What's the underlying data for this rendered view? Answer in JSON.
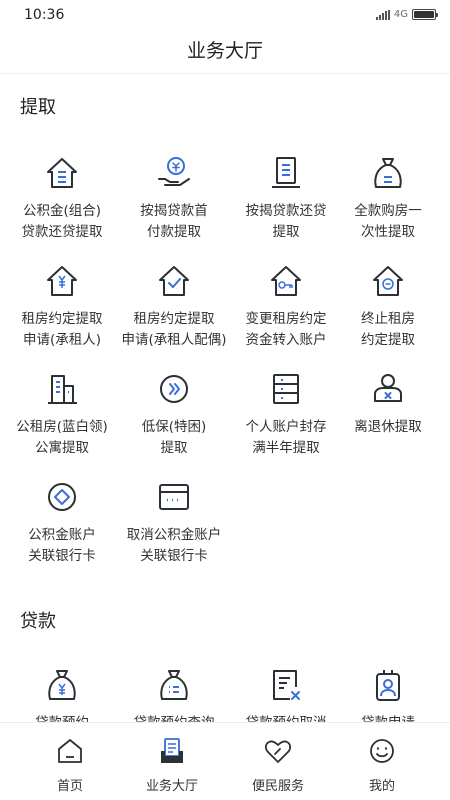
{
  "status_bar": {
    "time": "10:36",
    "network": "4G"
  },
  "header": {
    "title": "业务大厅"
  },
  "sections": [
    {
      "title": "提取",
      "items": [
        {
          "line1": "公积金(组合)",
          "line2": "贷款还贷提取",
          "icon": "house-list-icon"
        },
        {
          "line1": "按揭贷款首",
          "line2": "付款提取",
          "icon": "hand-coin-icon"
        },
        {
          "line1": "按揭贷款还贷",
          "line2": "提取",
          "icon": "receipt-icon"
        },
        {
          "line1": "全款购房一",
          "line2": "次性提取",
          "icon": "money-bag-icon"
        },
        {
          "line1": "租房约定提取",
          "line2": "申请(承租人)",
          "icon": "house-yen-icon"
        },
        {
          "line1": "租房约定提取",
          "line2": "申请(承租人配偶)",
          "icon": "house-check-icon"
        },
        {
          "line1": "变更租房约定",
          "line2": "资金转入账户",
          "icon": "house-key-icon"
        },
        {
          "line1": "终止租房",
          "line2": "约定提取",
          "icon": "house-minus-icon"
        },
        {
          "line1": "公租房(蓝白领)",
          "line2": "公寓提取",
          "icon": "building-icon"
        },
        {
          "line1": "低保(特困)",
          "line2": "提取",
          "icon": "double-chevron-icon"
        },
        {
          "line1": "个人账户封存",
          "line2": "满半年提取",
          "icon": "archive-icon"
        },
        {
          "line1": "离退休提取",
          "line2": "",
          "icon": "retiree-icon"
        },
        {
          "line1": "公积金账户",
          "line2": "关联银行卡",
          "icon": "diamond-circle-icon"
        },
        {
          "line1": "取消公积金账户",
          "line2": "关联银行卡",
          "icon": "bank-card-icon"
        }
      ]
    },
    {
      "title": "贷款",
      "items": [
        {
          "line1": "贷款预约",
          "line2": "",
          "icon": "money-bag-yen-icon"
        },
        {
          "line1": "贷款预约查询",
          "line2": "",
          "icon": "money-bag-list-icon"
        },
        {
          "line1": "贷款预约取消",
          "line2": "",
          "icon": "document-cancel-icon"
        },
        {
          "line1": "贷款申请",
          "line2": "",
          "icon": "id-badge-icon"
        }
      ]
    }
  ],
  "tabs": [
    {
      "label": "首页",
      "icon": "home-icon"
    },
    {
      "label": "业务大厅",
      "icon": "hall-icon"
    },
    {
      "label": "便民服务",
      "icon": "heart-icon"
    },
    {
      "label": "我的",
      "icon": "smiley-icon"
    }
  ],
  "colors": {
    "accent": "#3A6FD8",
    "icon_dark": "#2B2F36",
    "text": "#333333"
  }
}
